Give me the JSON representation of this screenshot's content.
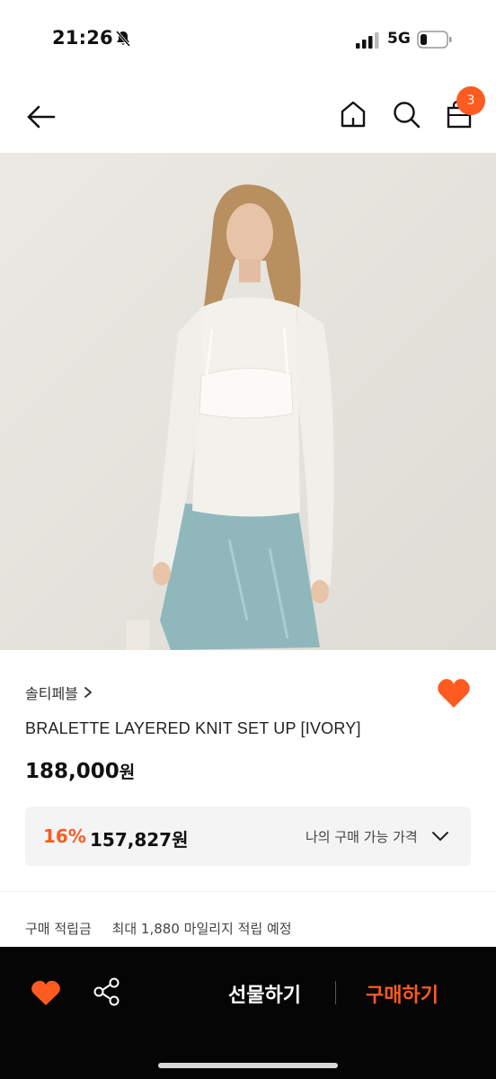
{
  "status": {
    "time": "21:26",
    "network": "5G"
  },
  "nav": {
    "cart_count": "3"
  },
  "product": {
    "brand": "솔티페블",
    "name": "BRALETTE LAYERED KNIT SET UP [IVORY]",
    "price": "188,000",
    "price_unit": "원"
  },
  "my_price": {
    "discount_rate": "16%",
    "discount_price": "157,827원",
    "label": "나의 구매 가능 가격"
  },
  "points": {
    "label": "구매 적립금",
    "value": "최대 1,880 마일리지 적립 예정"
  },
  "bottom_bar": {
    "gift_label": "선물하기",
    "buy_label": "구매하기"
  },
  "colors": {
    "accent": "#ff5a1f",
    "bottom_bar": "#050505",
    "price_box": "#f4f4f5"
  },
  "icons": [
    "bell-slash-icon",
    "signal-icon",
    "battery-icon",
    "back-arrow-icon",
    "home-icon",
    "search-icon",
    "shopping-bag-icon",
    "heart-icon",
    "chevron-right-icon",
    "chevron-down-icon",
    "share-icon"
  ]
}
